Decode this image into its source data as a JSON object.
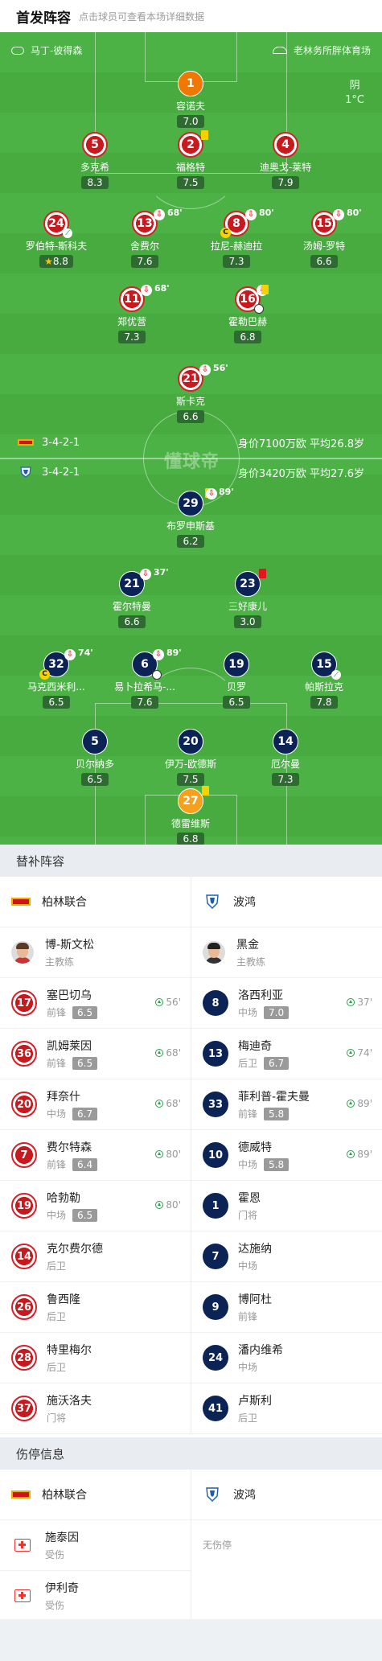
{
  "header": {
    "title": "首发阵容",
    "subtitle": "点击球员可查看本场详细数据"
  },
  "venue": {
    "left": "马丁-彼得森",
    "right": "老林务所胖体育场"
  },
  "weather": {
    "condition": "阴",
    "temp": "1°C"
  },
  "home": {
    "formation": "3-4-2-1",
    "stats": "身价7100万欧 平均26.8岁",
    "players": [
      {
        "num": "1",
        "name": "容诺夫",
        "rating": "7.0"
      },
      {
        "num": "5",
        "name": "多克希",
        "rating": "8.3"
      },
      {
        "num": "2",
        "name": "福格特",
        "rating": "7.5"
      },
      {
        "num": "4",
        "name": "迪奥戈-莱特",
        "rating": "7.9"
      },
      {
        "num": "24",
        "name": "罗伯特-斯科夫",
        "rating": "8.8"
      },
      {
        "num": "13",
        "name": "舍费尔",
        "rating": "7.6",
        "min": "68'"
      },
      {
        "num": "8",
        "name": "拉尼-赫迪拉",
        "rating": "7.3",
        "min": "80'"
      },
      {
        "num": "15",
        "name": "汤姆-罗特",
        "rating": "6.6",
        "min": "80'"
      },
      {
        "num": "11",
        "name": "郑优营",
        "rating": "7.3",
        "min": "68'"
      },
      {
        "num": "16",
        "name": "霍勒巴赫",
        "rating": "6.8"
      },
      {
        "num": "21",
        "name": "斯卡克",
        "rating": "6.6",
        "min": "56'"
      }
    ]
  },
  "away": {
    "formation": "3-4-2-1",
    "stats": "身价3420万欧 平均27.6岁",
    "players": [
      {
        "num": "29",
        "name": "布罗申斯基",
        "rating": "6.2",
        "min": "89'"
      },
      {
        "num": "21",
        "name": "霍尔特曼",
        "rating": "6.6",
        "min": "37'"
      },
      {
        "num": "23",
        "name": "三好康儿",
        "rating": "3.0"
      },
      {
        "num": "32",
        "name": "马克西米利...",
        "rating": "6.5",
        "min": "74'"
      },
      {
        "num": "6",
        "name": "易卜拉希马-...",
        "rating": "7.6",
        "min": "89'"
      },
      {
        "num": "19",
        "name": "贝罗",
        "rating": "6.5"
      },
      {
        "num": "15",
        "name": "帕斯拉克",
        "rating": "7.8"
      },
      {
        "num": "5",
        "name": "贝尔纳多",
        "rating": "6.5"
      },
      {
        "num": "20",
        "name": "伊万-欧德斯",
        "rating": "7.5"
      },
      {
        "num": "14",
        "name": "厄尔曼",
        "rating": "7.3"
      },
      {
        "num": "27",
        "name": "德雷维斯",
        "rating": "6.8"
      }
    ]
  },
  "watermark": "懂球帝",
  "bench": {
    "title": "替补阵容",
    "home_team": "柏林联合",
    "away_team": "波鸿",
    "home_coach": {
      "name": "博-斯文松",
      "role": "主教练"
    },
    "away_coach": {
      "name": "黑金",
      "role": "主教练"
    },
    "home": [
      {
        "num": "17",
        "name": "塞巴切乌",
        "pos": "前锋",
        "rating": "6.5",
        "min": "56'"
      },
      {
        "num": "36",
        "name": "凯姆莱因",
        "pos": "前锋",
        "rating": "6.5",
        "min": "68'"
      },
      {
        "num": "20",
        "name": "拜奈什",
        "pos": "中场",
        "rating": "6.7",
        "min": "68'"
      },
      {
        "num": "7",
        "name": "费尔特森",
        "pos": "前锋",
        "rating": "6.4",
        "min": "80'"
      },
      {
        "num": "19",
        "name": "哈勃勒",
        "pos": "中场",
        "rating": "6.5",
        "min": "80'"
      },
      {
        "num": "14",
        "name": "克尔费尔德",
        "pos": "后卫"
      },
      {
        "num": "26",
        "name": "鲁西隆",
        "pos": "后卫"
      },
      {
        "num": "28",
        "name": "特里梅尔",
        "pos": "后卫"
      },
      {
        "num": "37",
        "name": "施沃洛夫",
        "pos": "门将"
      }
    ],
    "away": [
      {
        "num": "8",
        "name": "洛西利亚",
        "pos": "中场",
        "rating": "7.0",
        "min": "37'"
      },
      {
        "num": "13",
        "name": "梅迪奇",
        "pos": "后卫",
        "rating": "6.7",
        "min": "74'"
      },
      {
        "num": "33",
        "name": "菲利普-霍夫曼",
        "pos": "前锋",
        "rating": "5.8",
        "min": "89'"
      },
      {
        "num": "10",
        "name": "德威特",
        "pos": "中场",
        "rating": "5.8",
        "min": "89'"
      },
      {
        "num": "1",
        "name": "霍恩",
        "pos": "门将"
      },
      {
        "num": "7",
        "name": "达施纳",
        "pos": "中场"
      },
      {
        "num": "9",
        "name": "博阿杜",
        "pos": "前锋"
      },
      {
        "num": "24",
        "name": "潘内维希",
        "pos": "中场"
      },
      {
        "num": "41",
        "name": "卢斯利",
        "pos": "后卫"
      }
    ]
  },
  "injury": {
    "title": "伤停信息",
    "home_team": "柏林联合",
    "away_team": "波鸿",
    "home": [
      {
        "name": "施泰因",
        "status": "受伤"
      },
      {
        "name": "伊利奇",
        "status": "受伤"
      }
    ],
    "away_none": "无伤停"
  }
}
